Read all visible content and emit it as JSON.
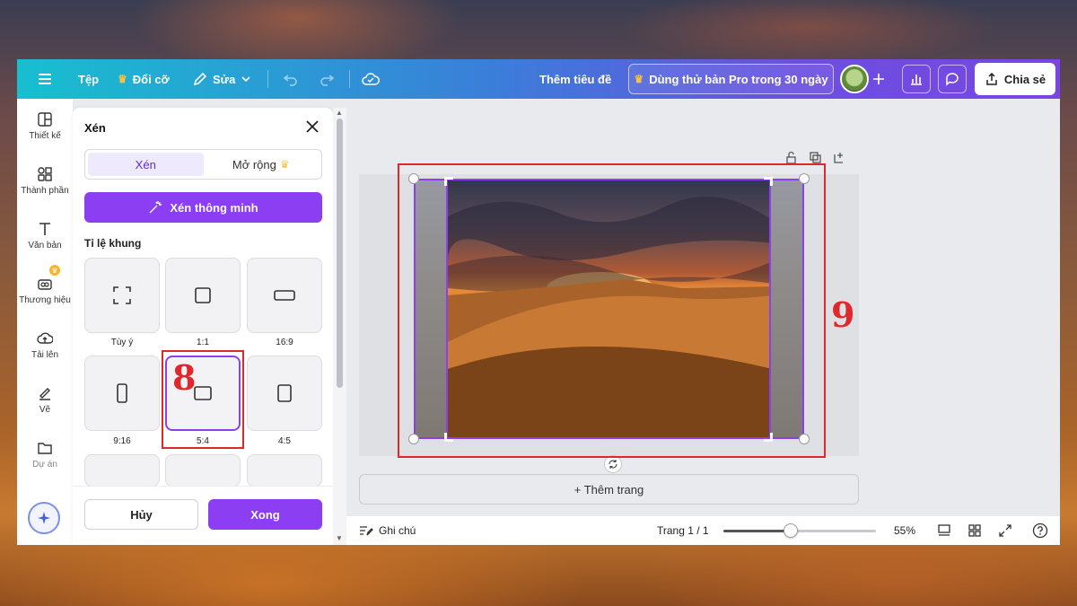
{
  "topbar": {
    "file_label": "Tệp",
    "resize_label": "Đổi cỡ",
    "edit_label": "Sửa",
    "title_label": "Thêm tiêu đề",
    "try_pro_label": "Dùng thử bản Pro trong 30 ngày",
    "share_label": "Chia sẻ"
  },
  "rail": {
    "items": [
      {
        "label": "Thiết kế",
        "icon": "layout-icon"
      },
      {
        "label": "Thành phần",
        "icon": "elements-icon"
      },
      {
        "label": "Văn bản",
        "icon": "text-icon"
      },
      {
        "label": "Thương hiệu",
        "icon": "brand-icon"
      },
      {
        "label": "Tải lên",
        "icon": "upload-icon"
      },
      {
        "label": "Vẽ",
        "icon": "draw-icon"
      },
      {
        "label": "Dự án",
        "icon": "folder-icon"
      }
    ]
  },
  "crop_panel": {
    "title": "Xén",
    "tabs": [
      {
        "label": "Xén",
        "active": true
      },
      {
        "label": "Mở rộng",
        "active": false
      }
    ],
    "smart_crop_label": "Xén thông minh",
    "ratio_heading": "Tỉ lệ khung",
    "ratios": [
      {
        "label": "Tùy ý",
        "selected": false
      },
      {
        "label": "1:1",
        "selected": false
      },
      {
        "label": "16:9",
        "selected": false
      },
      {
        "label": "9:16",
        "selected": false
      },
      {
        "label": "5:4",
        "selected": true
      },
      {
        "label": "4:5",
        "selected": false
      }
    ],
    "cancel_label": "Hủy",
    "done_label": "Xong"
  },
  "canvas": {
    "add_page_label": "+ Thêm trang"
  },
  "statusbar": {
    "notes_label": "Ghi chú",
    "page_label": "Trang 1 / 1",
    "zoom_label": "55%",
    "zoom_value": 0.44
  },
  "annotations": {
    "step_a": "8",
    "step_b": "9"
  },
  "colors": {
    "accent": "#8b3ef2",
    "annotation": "#e0282c"
  }
}
